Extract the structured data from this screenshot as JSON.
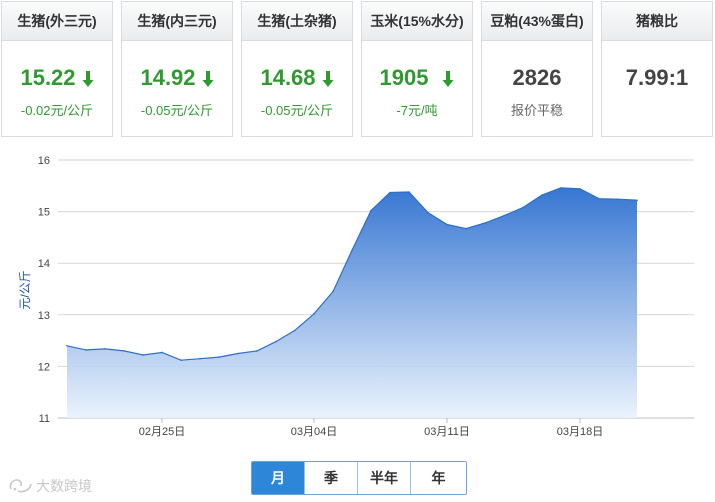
{
  "cards": [
    {
      "title": "生猪(外三元)",
      "price": "15.22",
      "change": "-0.02元/公斤",
      "trend": "down"
    },
    {
      "title": "生猪(内三元)",
      "price": "14.92",
      "change": "-0.05元/公斤",
      "trend": "down"
    },
    {
      "title": "生猪(土杂猪)",
      "price": "14.68",
      "change": "-0.05元/公斤",
      "trend": "down"
    },
    {
      "title": "玉米(15%水分)",
      "price": "1905",
      "change": "-7元/吨",
      "trend": "down"
    },
    {
      "title": "豆粕(43%蛋白)",
      "price": "2826",
      "change": "报价平稳",
      "trend": "flat"
    },
    {
      "title": "猪粮比",
      "price": "7.99:1",
      "change": "",
      "trend": "none"
    }
  ],
  "colors": {
    "down": "#2f9a2f",
    "line": "#2e6fc6",
    "active_button": "#2e86d8"
  },
  "chart_data": {
    "type": "area",
    "title": "",
    "xlabel": "",
    "ylabel": "元/公斤",
    "ylim": [
      11,
      16
    ],
    "yticks": [
      11,
      12,
      13,
      14,
      15,
      16
    ],
    "grid": true,
    "x": [
      "02-20",
      "02-21",
      "02-22",
      "02-23",
      "02-24",
      "02-25",
      "02-26",
      "02-27",
      "02-28",
      "02-29",
      "03-01",
      "03-02",
      "03-03",
      "03-04",
      "03-05",
      "03-06",
      "03-07",
      "03-08",
      "03-09",
      "03-10",
      "03-11",
      "03-12",
      "03-13",
      "03-14",
      "03-15",
      "03-16",
      "03-17",
      "03-18",
      "03-19",
      "03-20",
      "03-21",
      "03-22",
      "03-23",
      "03-24"
    ],
    "xtick_labels": [
      {
        "x": "02-25",
        "label": "02月25日"
      },
      {
        "x": "03-04",
        "label": "03月04日"
      },
      {
        "x": "03-11",
        "label": "03月11日"
      },
      {
        "x": "03-18",
        "label": "03月18日"
      }
    ],
    "series": [
      {
        "values": [
          12.4,
          12.32,
          12.34,
          12.3,
          12.22,
          12.27,
          12.12,
          12.15,
          12.18,
          12.25,
          12.3,
          12.48,
          12.7,
          13.02,
          13.45,
          14.25,
          15.02,
          15.37,
          15.38,
          14.98,
          14.75,
          14.67,
          14.78,
          14.92,
          15.08,
          15.32,
          15.46,
          15.44,
          15.25,
          15.24,
          15.22
        ]
      }
    ]
  },
  "range_buttons": [
    "月",
    "季",
    "半年",
    "年"
  ],
  "active_range": "月",
  "watermark": "大数跨境",
  "icons": {
    "down": "down-arrow-icon",
    "watermark": "logo-icon"
  }
}
